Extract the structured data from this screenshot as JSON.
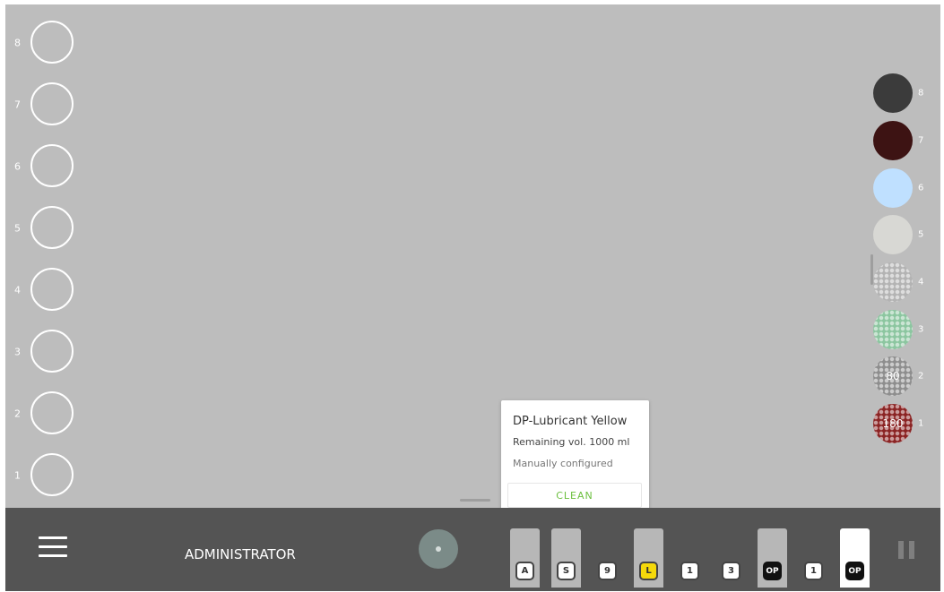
{
  "left_slots": [
    {
      "number": "8"
    },
    {
      "number": "7"
    },
    {
      "number": "6"
    },
    {
      "number": "5"
    },
    {
      "number": "4"
    },
    {
      "number": "3"
    },
    {
      "number": "2"
    },
    {
      "number": "1"
    }
  ],
  "right_slots": [
    {
      "number": "8",
      "color": "#3b3b3b",
      "pattern": "solid",
      "value": ""
    },
    {
      "number": "7",
      "color": "#3d1313",
      "pattern": "solid",
      "value": ""
    },
    {
      "number": "6",
      "color": "#bfe0ff",
      "pattern": "solid",
      "value": ""
    },
    {
      "number": "5",
      "color": "#d8d8d4",
      "pattern": "solid",
      "value": ""
    },
    {
      "number": "4",
      "color": "#b3b3b3",
      "pattern": "honeycomb",
      "value": ""
    },
    {
      "number": "3",
      "color": "#8cc6a0",
      "pattern": "honeycomb",
      "value": ""
    },
    {
      "number": "2",
      "color": "#8e8e8e",
      "pattern": "honeycomb",
      "value": "80"
    },
    {
      "number": "1",
      "color": "#8b2424",
      "pattern": "honeycomb",
      "value": "180"
    }
  ],
  "popover": {
    "title": "DP-Lubricant Yellow",
    "remaining": "Remaining vol. 1000 ml",
    "note": "Manually configured",
    "button": "CLEAN"
  },
  "bottom_bar": {
    "user": "ADMINISTRATOR",
    "trays": [
      {
        "badge": "A",
        "style": "white",
        "holder": true
      },
      {
        "badge": "S",
        "style": "white",
        "holder": true
      },
      {
        "badge": "9",
        "style": "white",
        "holder": false
      },
      {
        "badge": "L",
        "style": "yellow",
        "holder": true
      },
      {
        "badge": "1",
        "style": "white",
        "holder": false
      },
      {
        "badge": "3",
        "style": "white",
        "holder": false
      },
      {
        "badge": "OP",
        "style": "black",
        "holder": true
      },
      {
        "badge": "1",
        "style": "white",
        "holder": false
      },
      {
        "badge": "OP",
        "style": "black",
        "holder": "white"
      }
    ]
  },
  "colors": {
    "stage_bg": "#bdbdbd",
    "bar_bg": "#545454",
    "accent_green": "#6cbf3f",
    "lubricant_yellow": "#f5d90a"
  }
}
